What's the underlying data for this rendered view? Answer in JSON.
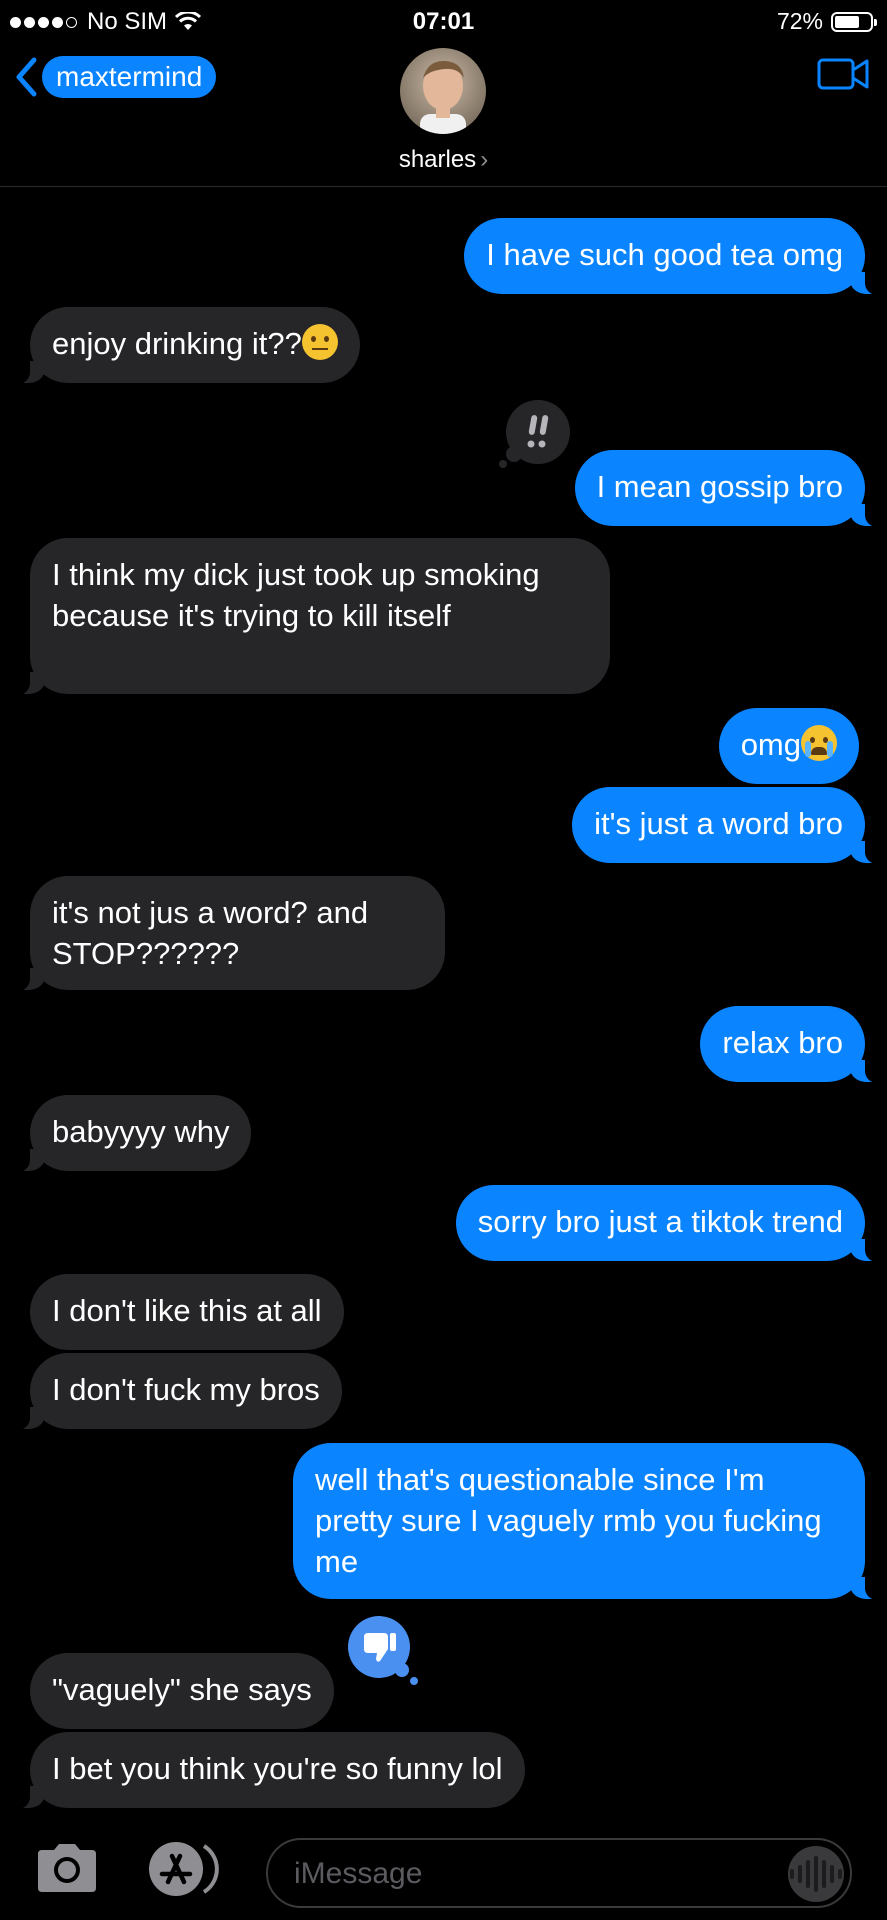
{
  "status_bar": {
    "carrier": "No SIM",
    "time": "07:01",
    "battery_percent": "72%",
    "battery_level": 0.72
  },
  "header": {
    "back_label": "maxtermind",
    "contact_name": "sharles"
  },
  "messages": [
    {
      "text": "I have such good tea omg",
      "direction": "outgoing"
    },
    {
      "text": "enjoy drinking it??",
      "direction": "incoming",
      "emoji": "raised-eyebrow-face"
    },
    {
      "text": "I mean gossip bro",
      "direction": "outgoing",
      "tapback": "exclamation"
    },
    {
      "text": "I think my dick just took up smoking because it's trying to kill itself",
      "direction": "incoming"
    },
    {
      "text": "omg",
      "direction": "outgoing",
      "emoji": "loudly-crying-face"
    },
    {
      "text": "it's just a word bro",
      "direction": "outgoing"
    },
    {
      "text": "it's not jus a word? and STOP??????",
      "direction": "incoming"
    },
    {
      "text": "relax bro",
      "direction": "outgoing"
    },
    {
      "text": "babyyyy why",
      "direction": "incoming"
    },
    {
      "text": "sorry bro just a tiktok trend",
      "direction": "outgoing"
    },
    {
      "text": "I don't like this at all",
      "direction": "incoming"
    },
    {
      "text": "I don't fuck my bros",
      "direction": "incoming"
    },
    {
      "text": "well that's questionable since I'm pretty sure I vaguely rmb you fucking me",
      "direction": "outgoing"
    },
    {
      "text": "\"vaguely\" she says",
      "direction": "incoming",
      "tapback": "thumbs-down"
    },
    {
      "text": "I bet you think you're so funny lol",
      "direction": "incoming"
    }
  ],
  "input": {
    "placeholder": "iMessage"
  },
  "icons": {
    "back": "chevron-left-icon",
    "video": "video-camera-icon",
    "camera": "camera-icon",
    "apps": "app-store-icon",
    "audio": "audio-waveform-icon"
  },
  "colors": {
    "outgoing_bubble": "#0a84ff",
    "incoming_bubble": "#262629",
    "background": "#000000"
  }
}
